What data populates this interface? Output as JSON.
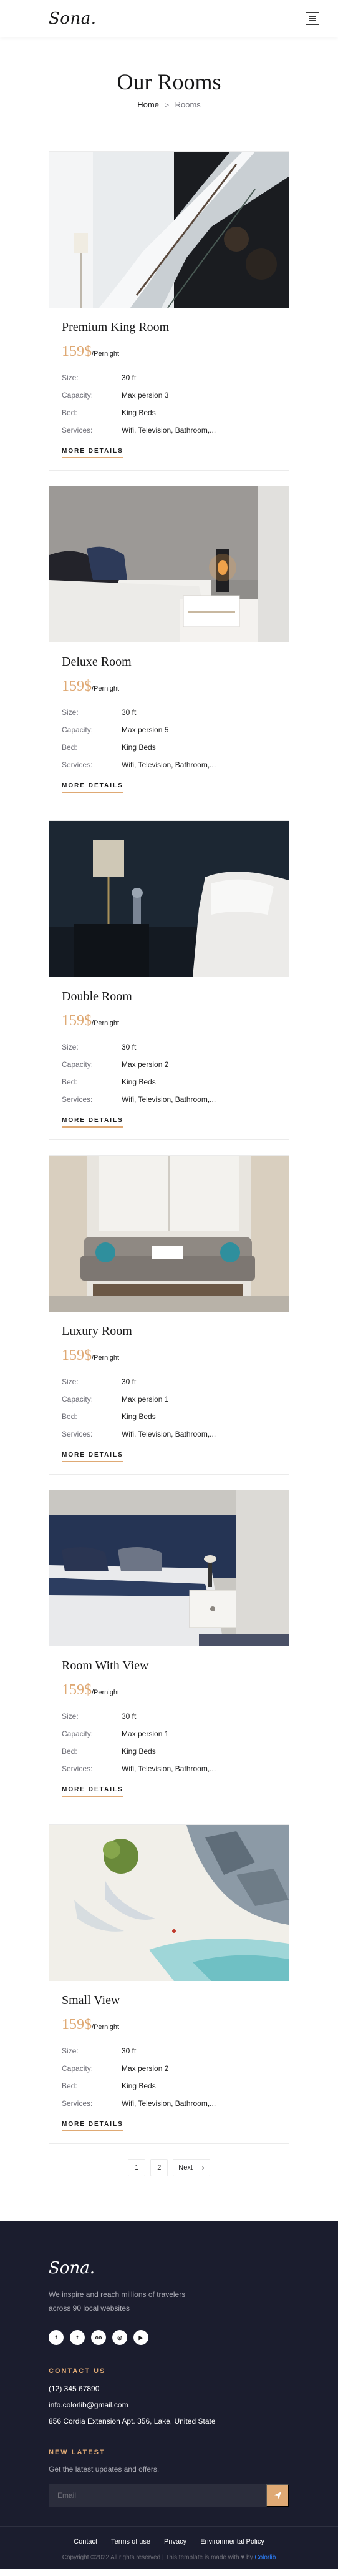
{
  "header": {
    "logo": "Sona."
  },
  "breadcrumb": {
    "title": "Our Rooms",
    "home": "Home",
    "separator": ">",
    "current": "Rooms"
  },
  "spec_labels": {
    "size": "Size:",
    "capacity": "Capacity:",
    "bed": "Bed:",
    "services": "Services:"
  },
  "rooms": [
    {
      "name": "Premium King Room",
      "price": "159$",
      "per": "/Pernight",
      "size": "30 ft",
      "capacity": "Max persion 3",
      "bed": "King Beds",
      "services": "Wifi, Television, Bathroom,...",
      "more": "MORE DETAILS"
    },
    {
      "name": "Deluxe Room",
      "price": "159$",
      "per": "/Pernight",
      "size": "30 ft",
      "capacity": "Max persion 5",
      "bed": "King Beds",
      "services": "Wifi, Television, Bathroom,...",
      "more": "MORE DETAILS"
    },
    {
      "name": "Double Room",
      "price": "159$",
      "per": "/Pernight",
      "size": "30 ft",
      "capacity": "Max persion 2",
      "bed": "King Beds",
      "services": "Wifi, Television, Bathroom,...",
      "more": "MORE DETAILS"
    },
    {
      "name": "Luxury Room",
      "price": "159$",
      "per": "/Pernight",
      "size": "30 ft",
      "capacity": "Max persion 1",
      "bed": "King Beds",
      "services": "Wifi, Television, Bathroom,...",
      "more": "MORE DETAILS"
    },
    {
      "name": "Room With View",
      "price": "159$",
      "per": "/Pernight",
      "size": "30 ft",
      "capacity": "Max persion 1",
      "bed": "King Beds",
      "services": "Wifi, Television, Bathroom,...",
      "more": "MORE DETAILS"
    },
    {
      "name": "Small View",
      "price": "159$",
      "per": "/Pernight",
      "size": "30 ft",
      "capacity": "Max persion 2",
      "bed": "King Beds",
      "services": "Wifi, Television, Bathroom,...",
      "more": "MORE DETAILS"
    }
  ],
  "pagination": {
    "page1": "1",
    "page2": "2",
    "next": "Next"
  },
  "footer": {
    "logo": "Sona.",
    "description": "We inspire and reach millions of travelers across 90 local websites",
    "contact_heading": "CONTACT US",
    "phone": "(12) 345 67890",
    "email": "info.colorlib@gmail.com",
    "address": "856 Cordia Extension Apt. 356, Lake, United State",
    "newsletter_heading": "NEW LATEST",
    "newsletter_text": "Get the latest updates and offers.",
    "email_placeholder": "Email",
    "links": [
      "Contact",
      "Terms of use",
      "Privacy",
      "Environmental Policy"
    ],
    "copyright": "Copyright ©2022 All rights reserved | This template is made with ♥ by",
    "copyright_brand": "Colorlib"
  },
  "colors": {
    "accent": "#dfa974",
    "footer_bg": "#1b1d2e",
    "text": "#19191a",
    "muted": "#707079"
  }
}
